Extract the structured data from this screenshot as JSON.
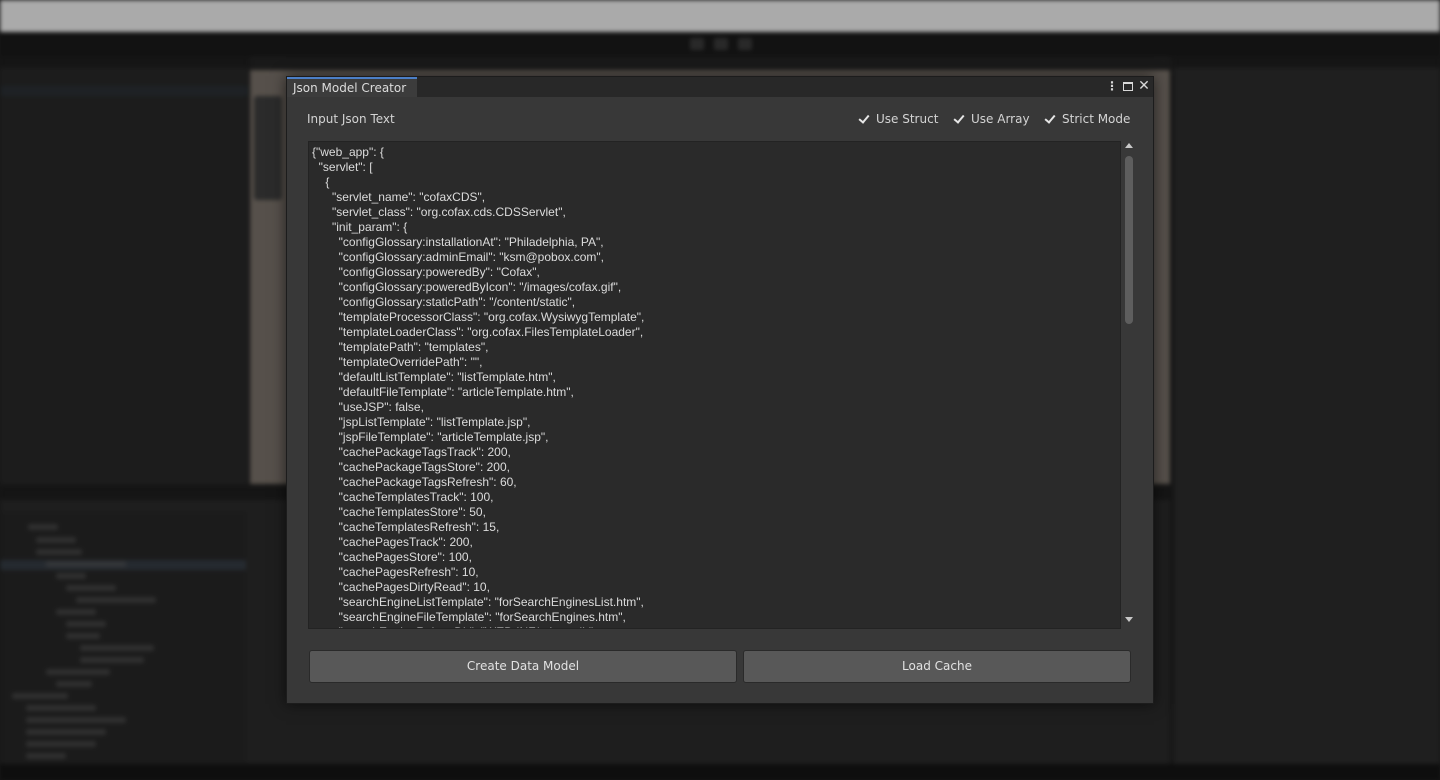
{
  "window": {
    "tab_title": "Json Model Creator",
    "input_label": "Input Json Text",
    "options": {
      "use_struct": {
        "label": "Use Struct",
        "checked": true
      },
      "use_array": {
        "label": "Use Array",
        "checked": true
      },
      "strict_mode": {
        "label": "Strict Mode",
        "checked": true
      }
    },
    "json_text": "{\"web_app\": {\n  \"servlet\": [\n    {\n      \"servlet_name\": \"cofaxCDS\",\n      \"servlet_class\": \"org.cofax.cds.CDSServlet\",\n      \"init_param\": {\n        \"configGlossary:installationAt\": \"Philadelphia, PA\",\n        \"configGlossary:adminEmail\": \"ksm@pobox.com\",\n        \"configGlossary:poweredBy\": \"Cofax\",\n        \"configGlossary:poweredByIcon\": \"/images/cofax.gif\",\n        \"configGlossary:staticPath\": \"/content/static\",\n        \"templateProcessorClass\": \"org.cofax.WysiwygTemplate\",\n        \"templateLoaderClass\": \"org.cofax.FilesTemplateLoader\",\n        \"templatePath\": \"templates\",\n        \"templateOverridePath\": \"\",\n        \"defaultListTemplate\": \"listTemplate.htm\",\n        \"defaultFileTemplate\": \"articleTemplate.htm\",\n        \"useJSP\": false,\n        \"jspListTemplate\": \"listTemplate.jsp\",\n        \"jspFileTemplate\": \"articleTemplate.jsp\",\n        \"cachePackageTagsTrack\": 200,\n        \"cachePackageTagsStore\": 200,\n        \"cachePackageTagsRefresh\": 60,\n        \"cacheTemplatesTrack\": 100,\n        \"cacheTemplatesStore\": 50,\n        \"cacheTemplatesRefresh\": 15,\n        \"cachePagesTrack\": 200,\n        \"cachePagesStore\": 100,\n        \"cachePagesRefresh\": 10,\n        \"cachePagesDirtyRead\": 10,\n        \"searchEngineListTemplate\": \"forSearchEnginesList.htm\",\n        \"searchEngineFileTemplate\": \"forSearchEngines.htm\",\n        \"searchEngineRobotsDb\": \"WEB-INF/robots.db\",",
    "buttons": {
      "create": "Create Data Model",
      "load": "Load Cache"
    }
  },
  "icons": {
    "menu": "kebab-menu-icon",
    "maximize": "maximize-icon",
    "close": "close-icon",
    "check": "checkmark-icon"
  },
  "colors": {
    "window_bg": "#383838",
    "editor_bg": "#2a2a2a",
    "button_bg": "#585858",
    "tab_accent": "#4c7fc7"
  }
}
